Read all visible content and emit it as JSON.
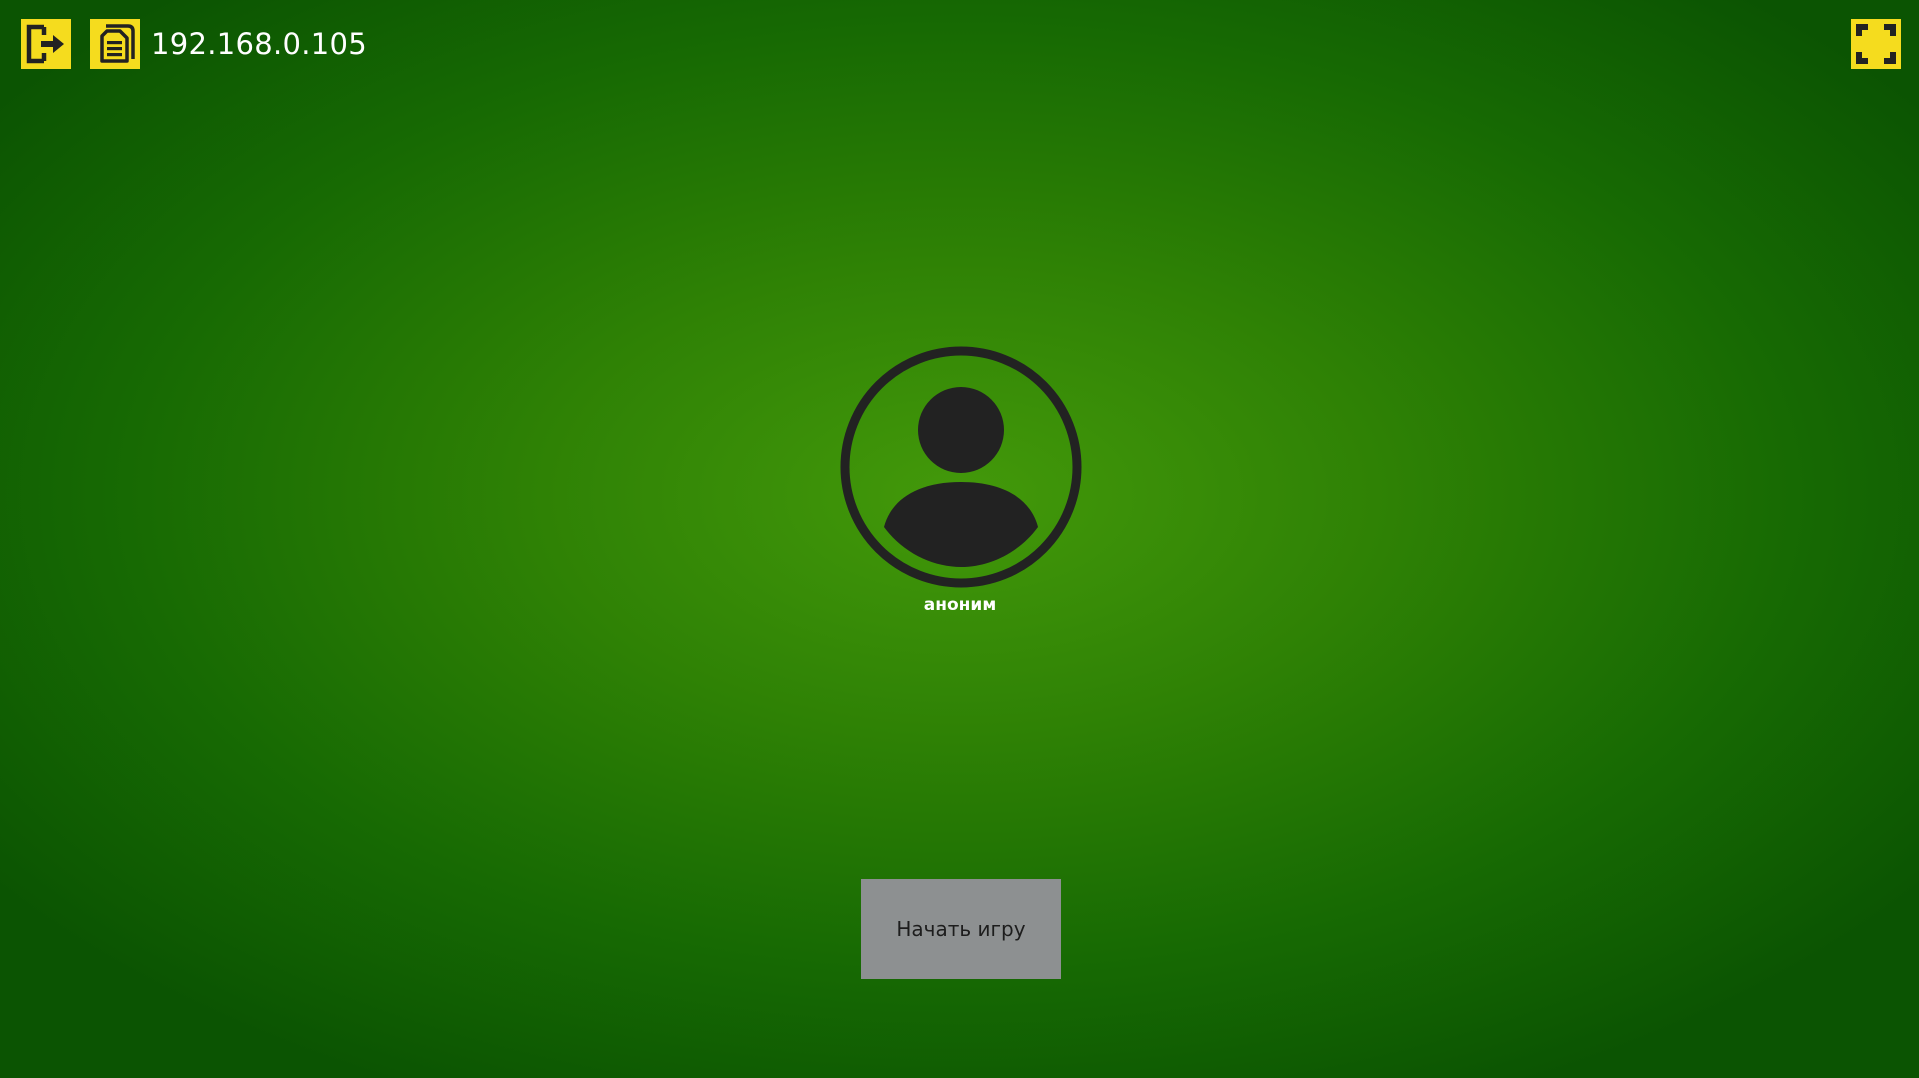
{
  "header": {
    "server_address": "192.168.0.105",
    "exit_icon": "exit-icon",
    "log_icon": "document-icon",
    "fullscreen_icon": "fullscreen-icon"
  },
  "profile": {
    "avatar_icon": "user-avatar-icon",
    "name": "аноним"
  },
  "actions": {
    "start_label": "Начать игру"
  },
  "colors": {
    "accent_yellow": "#f5dc1e",
    "background_center": "#43990a",
    "background_edge": "#0b5402",
    "button_gray": "#8d9091",
    "icon_dark": "#222222"
  }
}
